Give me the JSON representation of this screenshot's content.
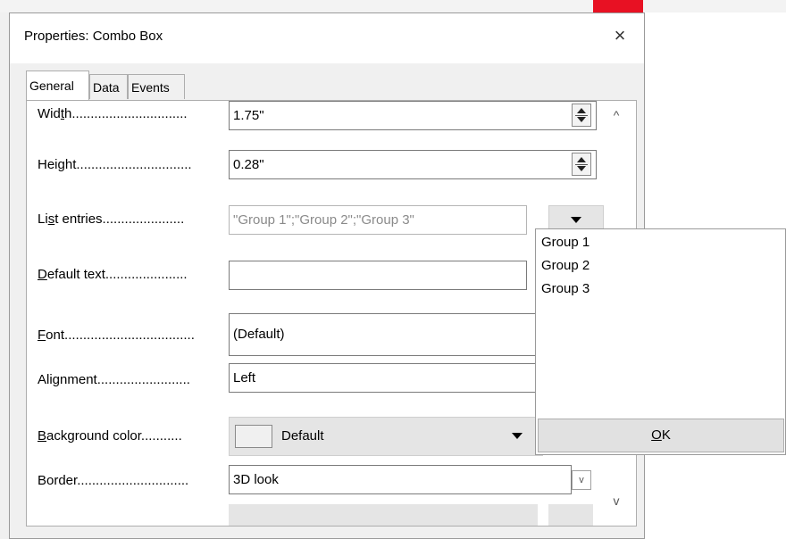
{
  "dialog": {
    "title": "Properties: Combo Box",
    "close_icon": "×"
  },
  "tabs": [
    "General",
    "Data",
    "Events"
  ],
  "fields": {
    "width": {
      "label_pre": "Wid",
      "label_u": "t",
      "label_post": "h",
      "dots": "...............................",
      "value": "1.75\""
    },
    "height": {
      "label_pre": "Hei",
      "label_u": "g",
      "label_post": "ht",
      "dots": "...............................",
      "value": "0.28\""
    },
    "list_entries": {
      "label_pre": "Li",
      "label_u": "s",
      "label_post": "t entries",
      "dots": "......................",
      "value": "\"Group 1\";\"Group 2\";\"Group 3\""
    },
    "default_text": {
      "label_pre": "",
      "label_u": "D",
      "label_post": "efault text",
      "dots": "......................",
      "value": ""
    },
    "font": {
      "label_pre": "",
      "label_u": "F",
      "label_post": "ont",
      "dots": "...................................",
      "value": "(Default)"
    },
    "alignment": {
      "label_pre": "Ali",
      "label_u": "g",
      "label_post": "nment",
      "dots": ".........................",
      "value": "Left"
    },
    "background_color": {
      "label_pre": "",
      "label_u": "B",
      "label_post": "ackground color",
      "dots": "...........",
      "value": "Default"
    },
    "border": {
      "label_pre": "Border",
      "label_u": "",
      "label_post": "",
      "dots": "..............................",
      "value": "3D look"
    }
  },
  "popup": {
    "items": [
      "Group 1",
      "Group 2",
      "Group 3"
    ],
    "ok_u": "O",
    "ok_rest": "K"
  },
  "icons": {
    "scroll_up": "^",
    "scroll_down": "v",
    "chevron_down": "v"
  }
}
